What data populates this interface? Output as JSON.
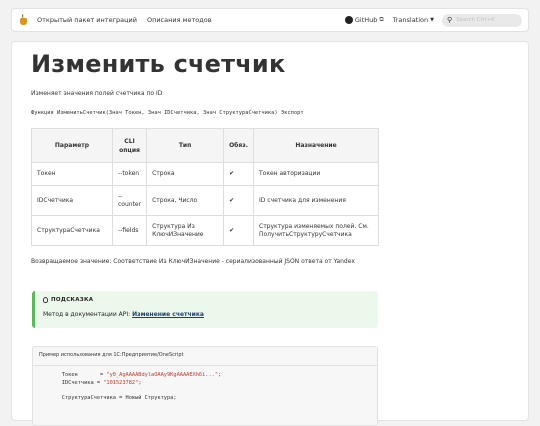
{
  "nav": {
    "link1": "Открытый пакет интеграций",
    "link2": "Описания методов",
    "github": "GitHub",
    "translation": "Translation",
    "search_placeholder": "Search Ctrl+K"
  },
  "page": {
    "title": "Изменить счетчик",
    "subtitle": "Изменяет значения полей счетчика по ID",
    "signature": "Функция ИзменитьСчетчик(Знач Токен, Знач IDСчетчика, Знач СтруктураСчетчика) Экспорт",
    "return_value": "Возвращаемое значение: Соответствие Из КлючИЗначение - сериализованный JSON ответа от Yandex"
  },
  "table": {
    "headers": [
      "Параметр",
      "CLI опция",
      "Тип",
      "Обяз.",
      "Назначение"
    ],
    "rows": [
      [
        "Токен",
        "--token",
        "Строка",
        "✔",
        "Токен авторизации"
      ],
      [
        "IDСчетчика",
        "--counter",
        "Строка, Число",
        "✔",
        "ID счетчика для изменения"
      ],
      [
        "СтруктураСчетчика",
        "--fields",
        "Структура Из КлючИЗначение",
        "✔",
        "Структура изменяемых полей. См. ПолучитьСтруктуруСчетчика"
      ]
    ]
  },
  "hint": {
    "label": "ПОДСКАЗКА",
    "text": "Метод в документации API: ",
    "link": "Изменение счетчика"
  },
  "code": {
    "header": "Пример использования для 1С:Предприятие/OneScript",
    "line1_var": "    Токен       = ",
    "line1_val": "\"y0_AgAAAABdylaOAAy9KgAAAAEXh6i...\"",
    "line1_end": ";",
    "line2_var": "    IDСчетчика = ",
    "line2_val": "\"101523782\"",
    "line2_end": ";",
    "line3": "    СтруктураСчетчика = Новый Структура;"
  }
}
